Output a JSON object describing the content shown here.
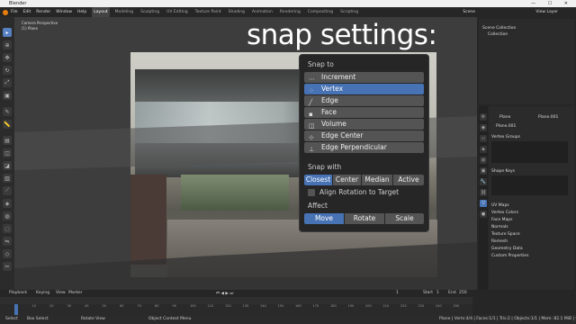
{
  "window": {
    "title": "Blender",
    "controls": "— ☐ ✕"
  },
  "menu": {
    "items": [
      "File",
      "Edit",
      "Render",
      "Window",
      "Help"
    ],
    "workspaces": [
      "Layout",
      "Modeling",
      "Sculpting",
      "UV Editing",
      "Texture Paint",
      "Shading",
      "Animation",
      "Rendering",
      "Compositing",
      "Scripting"
    ],
    "active_workspace": "Layout",
    "scene": "Scene",
    "view_layer": "View Layer"
  },
  "viewport": {
    "info_line1": "Camera Perspective",
    "info_line2": "(1) Plane",
    "overlay_title": "snap settings:"
  },
  "snap_popover": {
    "snap_to_label": "Snap to",
    "snap_to_options": [
      {
        "label": "Increment",
        "icon": "increment-icon",
        "selected": false
      },
      {
        "label": "Vertex",
        "icon": "vertex-icon",
        "selected": true
      },
      {
        "label": "Edge",
        "icon": "edge-icon",
        "selected": false
      },
      {
        "label": "Face",
        "icon": "face-icon",
        "selected": false
      },
      {
        "label": "Volume",
        "icon": "volume-icon",
        "selected": false
      },
      {
        "label": "Edge Center",
        "icon": "edge-center-icon",
        "selected": false
      },
      {
        "label": "Edge Perpendicular",
        "icon": "edge-perpendicular-icon",
        "selected": false
      }
    ],
    "snap_with_label": "Snap with",
    "snap_with_options": [
      "Closest",
      "Center",
      "Median",
      "Active"
    ],
    "snap_with_selected": "Closest",
    "align_rotation_label": "Align Rotation to Target",
    "align_rotation_checked": false,
    "affect_label": "Affect",
    "affect_options": [
      "Move",
      "Rotate",
      "Scale"
    ],
    "affect_selected": "Move",
    "accent_color": "#4772b3"
  },
  "outliner": {
    "rows": [
      "Scene Collection",
      "Collection"
    ]
  },
  "properties": {
    "object_name": "Plane",
    "mesh_field": "Plane.001",
    "mesh_data": "Plane.001",
    "panels": [
      "Vertex Groups",
      "Shape Keys",
      "UV Maps",
      "Vertex Colors",
      "Face Maps",
      "Normals",
      "Texture Space",
      "Remesh",
      "Geometry Data",
      "Custom Properties"
    ]
  },
  "timeline": {
    "menus": [
      "Playback",
      "Keying",
      "View",
      "Marker"
    ],
    "current_frame": "1",
    "start_label": "Start",
    "start": "1",
    "end_label": "End",
    "end": "250",
    "ruler_ticks": [
      "0",
      "10",
      "20",
      "30",
      "40",
      "50",
      "60",
      "70",
      "80",
      "90",
      "100",
      "110",
      "120",
      "130",
      "140",
      "150",
      "160",
      "170",
      "180",
      "190",
      "200",
      "210",
      "220",
      "230",
      "240",
      "250"
    ]
  },
  "statusbar": {
    "select": "Select",
    "box_select": "Box Select",
    "rotate_view": "Rotate View",
    "object_menu": "Object Context Menu",
    "stats": "Plane | Verts:4/4 | Faces:1/1 | Tris:2 | Objects:1/1 | Mem: 82.1 MiB | v2.81.16"
  }
}
